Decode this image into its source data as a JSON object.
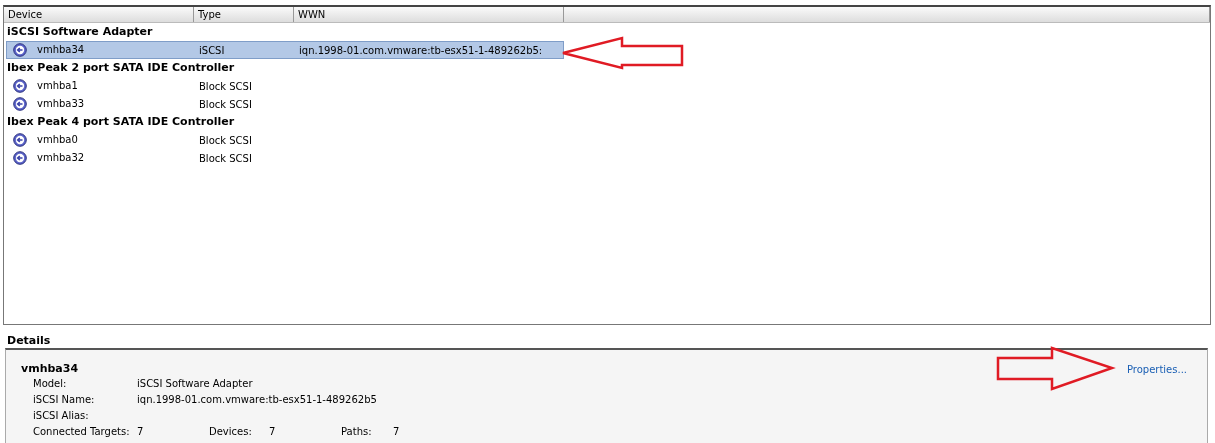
{
  "table": {
    "columns": [
      "Device",
      "Type",
      "WWN"
    ],
    "groups": [
      {
        "title": "iSCSI Software Adapter",
        "rows": [
          {
            "device": "vmhba34",
            "type": "iSCSI",
            "wwn": "iqn.1998-01.com.vmware:tb-esx51-1-489262b5:",
            "selected": true
          }
        ]
      },
      {
        "title": "Ibex Peak 2 port SATA IDE Controller",
        "rows": [
          {
            "device": "vmhba1",
            "type": "Block SCSI",
            "selected": false
          },
          {
            "device": "vmhba33",
            "type": "Block SCSI",
            "selected": false
          }
        ]
      },
      {
        "title": "Ibex Peak 4 port SATA IDE Controller",
        "rows": [
          {
            "device": "vmhba0",
            "type": "Block SCSI",
            "selected": false
          },
          {
            "device": "vmhba32",
            "type": "Block SCSI",
            "selected": false
          }
        ]
      }
    ]
  },
  "details": {
    "heading": "Details",
    "name": "vmhba34",
    "link": "Properties...",
    "fields": [
      {
        "label": "Model:",
        "value": "iSCSI Software Adapter"
      },
      {
        "label": "iSCSI Name:",
        "value": "iqn.1998-01.com.vmware:tb-esx51-1-489262b5"
      },
      {
        "label": "iSCSI Alias:"
      }
    ],
    "counts": [
      {
        "label": "Connected Targets:",
        "value": "7"
      },
      {
        "label": "Devices:",
        "value": "7"
      },
      {
        "label": "Paths:",
        "value": "7"
      }
    ]
  }
}
